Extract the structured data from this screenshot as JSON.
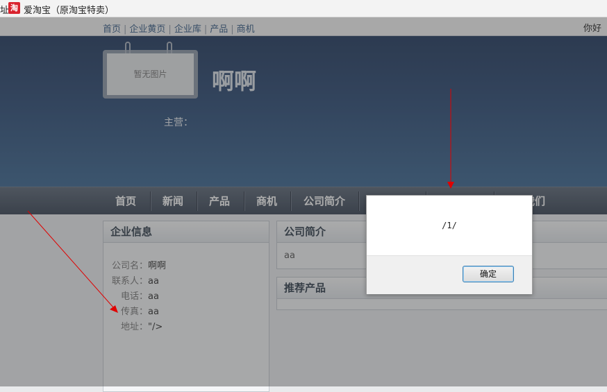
{
  "bookmark_bar": {
    "prefix": "址",
    "icon_glyph": "淘",
    "label": "爱淘宝（原淘宝特卖）"
  },
  "top_nav": {
    "items": [
      "首页",
      "企业黄页",
      "企业库",
      "产品",
      "商机"
    ],
    "separator": "|",
    "greeting": "你好"
  },
  "banner": {
    "photo_placeholder": "暂无图片",
    "company_name": "啊啊",
    "main_business": "主营："
  },
  "main_nav": {
    "items": [
      "首页",
      "新闻",
      "产品",
      "商机",
      "公司简介",
      "",
      "",
      "我们"
    ]
  },
  "company_info": {
    "title": "企业信息",
    "rows": [
      {
        "label": "公司名：",
        "value": "啊啊"
      },
      {
        "label": "联系人：",
        "value": "aa"
      },
      {
        "label": "电话：",
        "value": "aa"
      },
      {
        "label": "传真：",
        "value": "aa"
      },
      {
        "label": "地址：",
        "value": "\"/>"
      }
    ]
  },
  "intro": {
    "title": "公司简介",
    "text": "aa"
  },
  "products": {
    "title": "推荐产品"
  },
  "dialog": {
    "message": "/1/",
    "ok_label": "确定"
  },
  "colors": {
    "banner": "#2c4a74",
    "annotation": "#e00000",
    "dialog_button_border": "#3c7fb1"
  }
}
